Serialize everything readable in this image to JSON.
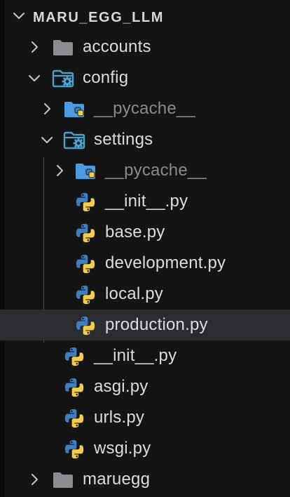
{
  "explorer": {
    "root": {
      "label": "MARU_EGG_LLM"
    },
    "items": [
      {
        "label": "accounts"
      },
      {
        "label": "config"
      },
      {
        "label": "__pycache__"
      },
      {
        "label": "settings"
      },
      {
        "label": "__pycache__"
      },
      {
        "label": "__init__.py"
      },
      {
        "label": "base.py"
      },
      {
        "label": "development.py"
      },
      {
        "label": "local.py"
      },
      {
        "label": "production.py"
      },
      {
        "label": "__init__.py"
      },
      {
        "label": "asgi.py"
      },
      {
        "label": "urls.py"
      },
      {
        "label": "wsgi.py"
      },
      {
        "label": "maruegg"
      }
    ],
    "selected_item": "production.py"
  },
  "colors": {
    "background": "#141414",
    "selected_row": "#2a2c30",
    "text": "#dcdcdc",
    "dim_text": "#8a8a8a",
    "folder_grey": "#8b8d90",
    "folder_blue": "#4f9be0",
    "config_folder": "#4aa0c8",
    "python_blue": "#3f7cc0",
    "python_yellow": "#f2cd45"
  }
}
